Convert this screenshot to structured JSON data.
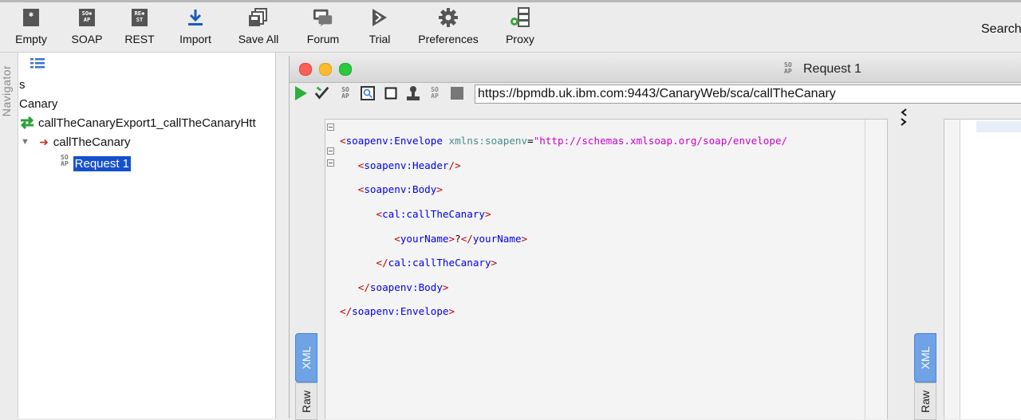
{
  "toolbar": {
    "buttons": [
      {
        "label": "Empty",
        "icon": "empty-project-icon"
      },
      {
        "label": "SOAP",
        "icon": "soap-icon"
      },
      {
        "label": "REST",
        "icon": "rest-icon"
      },
      {
        "label": "Import",
        "icon": "import-icon"
      },
      {
        "label": "Save All",
        "icon": "save-all-icon"
      },
      {
        "label": "Forum",
        "icon": "forum-icon"
      },
      {
        "label": "Trial",
        "icon": "trial-icon"
      },
      {
        "label": "Preferences",
        "icon": "gear-icon"
      },
      {
        "label": "Proxy",
        "icon": "proxy-icon"
      }
    ],
    "search_label": "Search"
  },
  "navigator": {
    "title": "Navigator",
    "tree": [
      {
        "label": "s"
      },
      {
        "label": "Canary"
      },
      {
        "label": "callTheCanaryExport1_callTheCanaryHtt"
      },
      {
        "label": "callTheCanary"
      },
      {
        "label": "Request 1",
        "selected": true
      }
    ]
  },
  "request_window": {
    "title": "Request 1",
    "url": "https://bpmdb.uk.ibm.com:9443/CanaryWeb/sca/callTheCanary",
    "editor_lines": [
      {
        "open": "<",
        "tag": "soapenv:Envelope",
        "attr": "xmlns:soapenv",
        "eq": "=",
        "val": "\"http://schemas.xmlsoap.org/soap/envelope/"
      },
      {
        "open": "<",
        "tag": "soapenv:Header",
        "close": "/>"
      },
      {
        "open": "<",
        "tag": "soapenv:Body",
        "close": ">"
      },
      {
        "open": "<",
        "tag": "cal:callTheCanary",
        "close": ">"
      },
      {
        "open": "<",
        "tag": "yourName",
        "close": ">",
        "text": "?",
        "open2": "</",
        "tag2": "yourName",
        "close2": ">"
      },
      {
        "open": "</",
        "tag": "cal:callTheCanary",
        "close": ">"
      },
      {
        "open": "</",
        "tag": "soapenv:Body",
        "close": ">"
      },
      {
        "open": "</",
        "tag": "soapenv:Envelope",
        "close": ">"
      }
    ],
    "tabs": {
      "xml": "XML",
      "raw": "Raw"
    },
    "response_tabs": {
      "xml": "XML",
      "raw": "Raw"
    }
  },
  "colors": {
    "accent": "#1550cc",
    "tag": "#0000e6",
    "bracket": "#c00000",
    "attribute": "#4a8a8a",
    "attribute_value": "#cc00cc"
  }
}
